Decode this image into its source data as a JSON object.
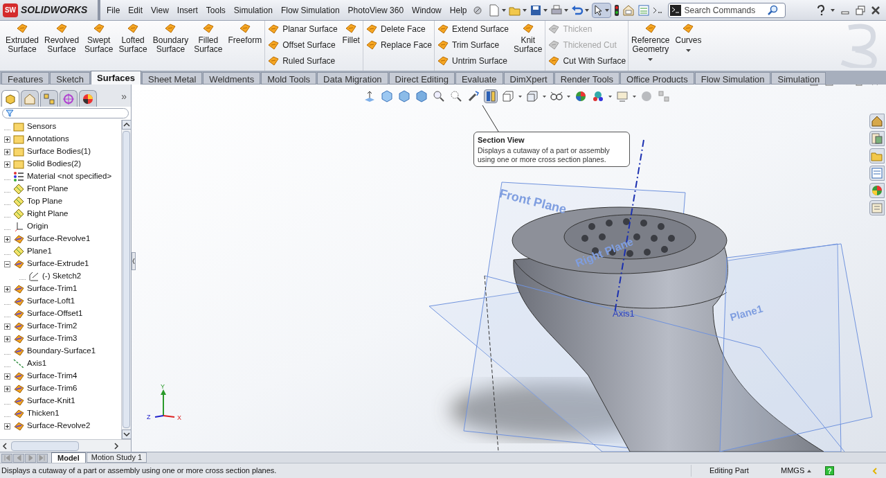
{
  "app": {
    "logo": "SOLIDWORKS",
    "logo_badge": "SW"
  },
  "menu": [
    "File",
    "Edit",
    "View",
    "Insert",
    "Tools",
    "Simulation",
    "Flow Simulation",
    "PhotoView 360",
    "Window",
    "Help"
  ],
  "search": {
    "placeholder": "Search Commands"
  },
  "ribbon": [
    {
      "groups": [
        {
          "kind": "large",
          "label": "Extruded\nSurface"
        },
        {
          "kind": "large",
          "label": "Revolved\nSurface"
        },
        {
          "kind": "large",
          "label": "Swept\nSurface"
        },
        {
          "kind": "large",
          "label": "Lofted\nSurface"
        },
        {
          "kind": "large",
          "label": "Boundary\nSurface"
        },
        {
          "kind": "large",
          "label": "Filled\nSurface"
        },
        {
          "kind": "large",
          "label": "Freeform"
        }
      ]
    },
    {
      "groups": [
        {
          "kind": "stack",
          "items": [
            {
              "label": "Planar Surface",
              "disabled": false
            },
            {
              "label": "Offset Surface",
              "disabled": false
            },
            {
              "label": "Ruled Surface",
              "disabled": false
            }
          ]
        },
        {
          "kind": "large",
          "label": "Fillet"
        }
      ]
    },
    {
      "groups": [
        {
          "kind": "stack",
          "items": [
            {
              "label": "Delete Face",
              "disabled": false
            },
            {
              "label": "Replace Face",
              "disabled": false
            }
          ]
        }
      ]
    },
    {
      "groups": [
        {
          "kind": "stack",
          "items": [
            {
              "label": "Extend Surface",
              "disabled": false
            },
            {
              "label": "Trim Surface",
              "disabled": false
            },
            {
              "label": "Untrim Surface",
              "disabled": false
            }
          ]
        },
        {
          "kind": "large",
          "label": "Knit\nSurface"
        }
      ]
    },
    {
      "groups": [
        {
          "kind": "stack",
          "items": [
            {
              "label": "Thicken",
              "disabled": true
            },
            {
              "label": "Thickened Cut",
              "disabled": true
            },
            {
              "label": "Cut With Surface",
              "disabled": false
            }
          ]
        }
      ]
    },
    {
      "groups": [
        {
          "kind": "dropdown",
          "label": "Reference\nGeometry"
        },
        {
          "kind": "dropdown",
          "label": "Curves"
        }
      ]
    }
  ],
  "tabs": [
    {
      "label": "Features",
      "selected": false
    },
    {
      "label": "Sketch",
      "selected": false
    },
    {
      "label": "Surfaces",
      "selected": true
    },
    {
      "label": "Sheet Metal",
      "selected": false
    },
    {
      "label": "Weldments",
      "selected": false
    },
    {
      "label": "Mold Tools",
      "selected": false
    },
    {
      "label": "Data Migration",
      "selected": false
    },
    {
      "label": "Direct Editing",
      "selected": false
    },
    {
      "label": "Evaluate",
      "selected": false
    },
    {
      "label": "DimXpert",
      "selected": false
    },
    {
      "label": "Render Tools",
      "selected": false
    },
    {
      "label": "Office Products",
      "selected": false
    },
    {
      "label": "Flow Simulation",
      "selected": false
    },
    {
      "label": "Simulation",
      "selected": false
    }
  ],
  "panel_tabs": [
    {
      "selected": true
    },
    {
      "selected": false
    },
    {
      "selected": false
    },
    {
      "selected": false
    },
    {
      "selected": false
    }
  ],
  "panel_more": "»",
  "tree": [
    {
      "label": "Sensors",
      "kind": "folder"
    },
    {
      "label": "Annotations",
      "kind": "folder",
      "expanded": false
    },
    {
      "label": "Surface Bodies(1)",
      "kind": "folder",
      "expanded": false
    },
    {
      "label": "Solid Bodies(2)",
      "kind": "folder",
      "expanded": false
    },
    {
      "label": "Material <not specified>",
      "kind": "material"
    },
    {
      "label": "Front Plane",
      "kind": "plane"
    },
    {
      "label": "Top Plane",
      "kind": "plane"
    },
    {
      "label": "Right Plane",
      "kind": "plane"
    },
    {
      "label": "Origin",
      "kind": "origin"
    },
    {
      "label": "Surface-Revolve1",
      "kind": "feature",
      "expanded": false
    },
    {
      "label": "Plane1",
      "kind": "plane"
    },
    {
      "label": "Surface-Extrude1",
      "kind": "feature",
      "expanded": true,
      "children": [
        {
          "label": "(-) Sketch2",
          "kind": "sketch"
        }
      ]
    },
    {
      "label": "Surface-Trim1",
      "kind": "feature",
      "expanded": false
    },
    {
      "label": "Surface-Loft1",
      "kind": "feature"
    },
    {
      "label": "Surface-Offset1",
      "kind": "feature"
    },
    {
      "label": "Surface-Trim2",
      "kind": "feature",
      "expanded": false
    },
    {
      "label": "Surface-Trim3",
      "kind": "feature",
      "expanded": false
    },
    {
      "label": "Boundary-Surface1",
      "kind": "feature"
    },
    {
      "label": "Axis1",
      "kind": "axis"
    },
    {
      "label": "Surface-Trim4",
      "kind": "feature",
      "expanded": false
    },
    {
      "label": "Surface-Trim6",
      "kind": "feature",
      "expanded": false
    },
    {
      "label": "Surface-Knit1",
      "kind": "feature"
    },
    {
      "label": "Thicken1",
      "kind": "feature"
    },
    {
      "label": "Surface-Revolve2",
      "kind": "feature",
      "expanded": false
    }
  ],
  "heads_up_toolbar": [
    {
      "selected": false
    },
    {
      "selected": false
    },
    {
      "selected": false
    },
    {
      "selected": false
    },
    {
      "selected": false
    },
    {
      "selected": false
    },
    {
      "selected": false
    },
    {
      "selected": true
    },
    {
      "selected": false
    },
    {
      "selected": false
    },
    {
      "selected": false
    },
    {
      "selected": false
    },
    {
      "selected": false
    },
    {
      "selected": false
    },
    {
      "selected": false
    },
    {
      "selected": false
    }
  ],
  "tooltip": {
    "title": "Section View",
    "text": "Displays a cutaway of a part or assembly using one or more cross section planes."
  },
  "viewport": {
    "plane_labels": [
      "Front Plane",
      "Right Plane",
      "Plane1"
    ],
    "axis_label": "Axis1",
    "triad": [
      "Y",
      "Z",
      "X"
    ]
  },
  "bottom_tabs": [
    {
      "label": "Model",
      "selected": true
    },
    {
      "label": "Motion Study 1",
      "selected": false
    }
  ],
  "status_bar": {
    "message": "Displays a cutaway of a part or assembly using one or more cross section planes.",
    "mode": "Editing Part",
    "units": "MMGS",
    "help": "?"
  }
}
